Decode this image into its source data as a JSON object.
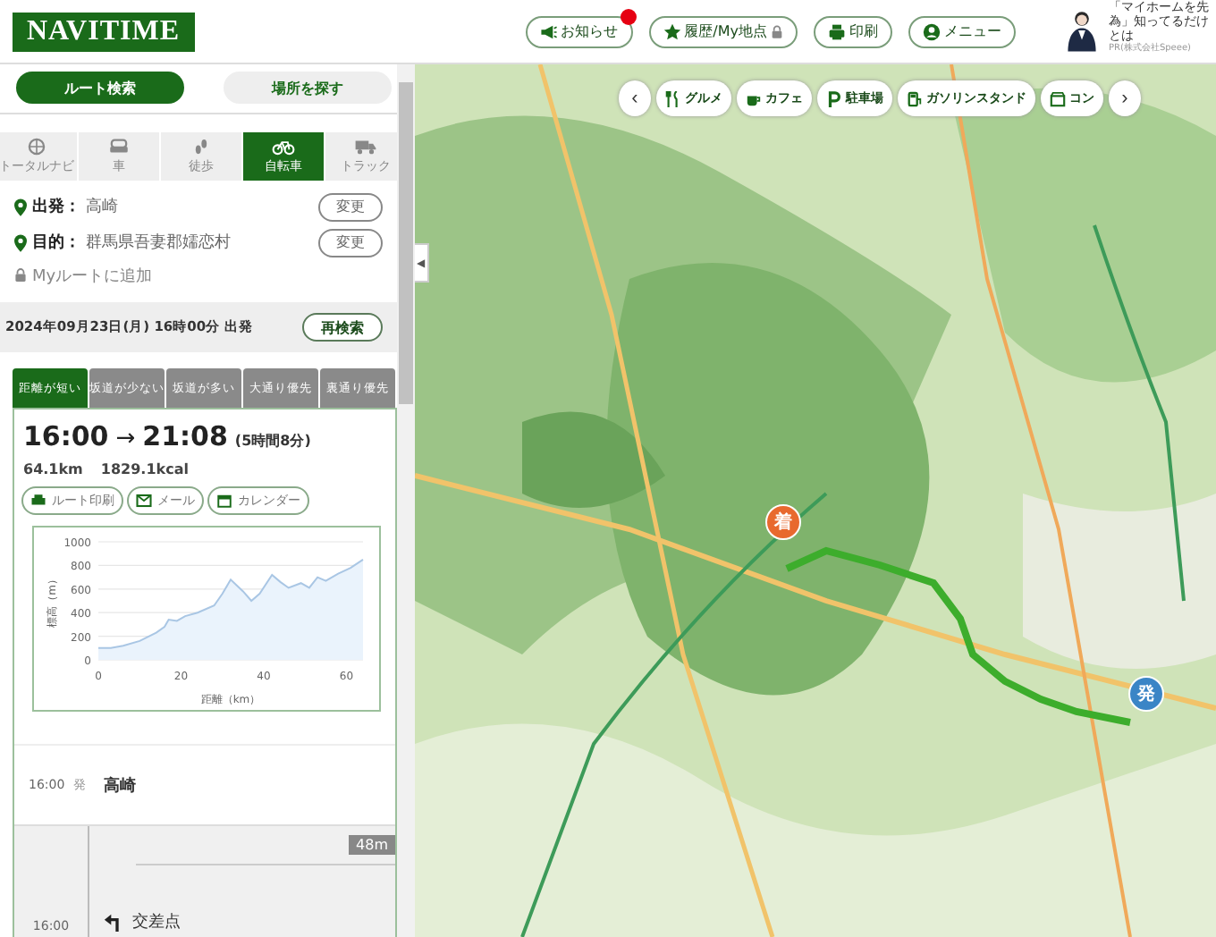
{
  "header": {
    "logo": "NAVITIME",
    "buttons": [
      {
        "label": "お知らせ",
        "kind": "notice",
        "unread": true
      },
      {
        "label": "履歴/My地点",
        "kind": "history",
        "unread": false
      },
      {
        "label": "印刷",
        "kind": "print",
        "unread": false
      },
      {
        "label": "メニュー",
        "kind": "menu",
        "unread": false
      }
    ],
    "ad": {
      "lines": [
        "「マイホームを先",
        "為」知ってるだけ",
        "とは"
      ],
      "sponsor": "PR(株式会社Speee)"
    }
  },
  "search_tabs": [
    {
      "label": "ルート検索",
      "selected": true
    },
    {
      "label": "場所を探す",
      "selected": false
    }
  ],
  "modes": [
    {
      "label": "トータルナビ",
      "kind": "total",
      "selected": false
    },
    {
      "label": "車",
      "kind": "car",
      "selected": false
    },
    {
      "label": "徒歩",
      "kind": "walk",
      "selected": false
    },
    {
      "label": "自転車",
      "kind": "bicycle",
      "selected": true
    },
    {
      "label": "トラック",
      "kind": "truck",
      "selected": false
    }
  ],
  "points": [
    {
      "label": "出発：",
      "value": "高崎",
      "button": "変更"
    },
    {
      "label": "目的：",
      "value": "群馬県吾妻郡嬬恋村",
      "button": "変更"
    }
  ],
  "my_route": "Myルートに追加",
  "departure": {
    "text": "2024年09月23日(月) 16時00分 出発",
    "button": "再検索"
  },
  "route_options": [
    {
      "label": "距離が短い",
      "selected": true
    },
    {
      "label": "坂道が少ない",
      "selected": false
    },
    {
      "label": "坂道が多い",
      "selected": false
    },
    {
      "label": "大通り優先",
      "selected": false
    },
    {
      "label": "裏通り優先",
      "selected": false
    }
  ],
  "result": {
    "depart_time": "16:00",
    "arrow": "→",
    "arrive_time": "21:08",
    "duration": "(5時間8分)",
    "distance": "64.1km",
    "calories": "1829.1kcal",
    "actions": [
      {
        "label": "ルート印刷",
        "kind": "print"
      },
      {
        "label": "メール",
        "kind": "mail"
      },
      {
        "label": "カレンダー",
        "kind": "calendar"
      }
    ],
    "chart_data": {
      "type": "area",
      "xlabel": "距離（km）",
      "ylabel": "標高（m）",
      "xlim": [
        0,
        64
      ],
      "ylim": [
        0,
        1000
      ],
      "xticks": [
        0,
        20,
        40,
        60
      ],
      "yticks": [
        0,
        200,
        400,
        600,
        800,
        1000
      ],
      "x": [
        0,
        3,
        6,
        10,
        14,
        16,
        17,
        19,
        21,
        24,
        28,
        30,
        32,
        35,
        37,
        39,
        42,
        44,
        46,
        49,
        51,
        53,
        55,
        58,
        61,
        64
      ],
      "grid": true,
      "series": [
        {
          "color": "#a9c6e4",
          "values": [
            100,
            100,
            120,
            160,
            230,
            280,
            340,
            330,
            370,
            400,
            460,
            560,
            680,
            580,
            500,
            560,
            720,
            660,
            610,
            650,
            610,
            700,
            670,
            730,
            780,
            850
          ]
        }
      ]
    }
  },
  "steps": [
    {
      "time": "16:00",
      "mark": "発",
      "name": "高崎"
    }
  ],
  "segment": {
    "distance": "48m",
    "time": "16:00",
    "turn": "交差点"
  },
  "map": {
    "collapse": "◀",
    "prev": "‹",
    "next": "›",
    "categories": [
      {
        "label": "グルメ",
        "kind": "food"
      },
      {
        "label": "カフェ",
        "kind": "cafe"
      },
      {
        "label": "駐車場",
        "kind": "parking"
      },
      {
        "label": "ガソリンスタンド",
        "kind": "gas"
      },
      {
        "label": "コン",
        "kind": "store"
      }
    ],
    "markers": [
      {
        "label": "着",
        "color": "#e8692e"
      },
      {
        "label": "発",
        "color": "#3a85c6"
      }
    ]
  }
}
